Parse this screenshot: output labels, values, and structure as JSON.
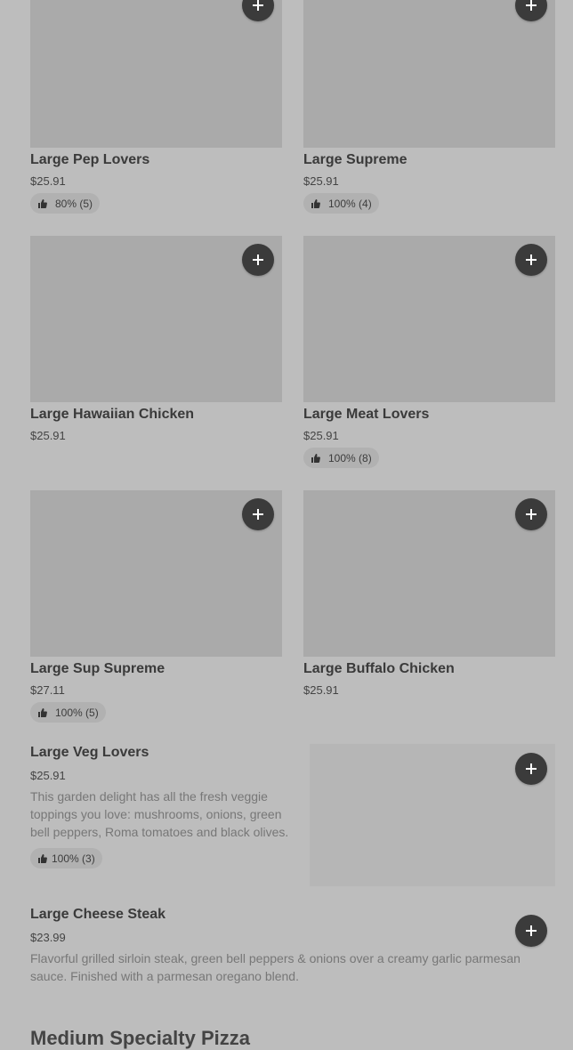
{
  "items": [
    {
      "name": "Large Pep Lovers",
      "price": "$25.91",
      "rating": "80% (5)"
    },
    {
      "name": "Large Supreme",
      "price": "$25.91",
      "rating": "100% (4)"
    },
    {
      "name": "Large Hawaiian Chicken",
      "price": "$25.91"
    },
    {
      "name": "Large Meat Lovers",
      "price": "$25.91",
      "rating": "100% (8)"
    },
    {
      "name": "Large Sup Supreme",
      "price": "$27.11",
      "rating": "100% (5)"
    },
    {
      "name": "Large Buffalo Chicken",
      "price": "$25.91"
    },
    {
      "name": "Large Veg Lovers",
      "price": "$25.91",
      "description": "This garden delight has all the fresh veggie toppings you love: mushrooms, onions, green bell peppers, Roma tomatoes and black olives.",
      "rating": "100% (3)"
    },
    {
      "name": "Large Cheese Steak",
      "price": "$23.99",
      "description": "Flavorful grilled sirloin steak, green bell peppers & onions over a creamy garlic parmesan sauce. Finished with a parmesan oregano blend."
    }
  ],
  "next_section_title": "Medium Specialty Pizza",
  "icons": {
    "add": "plus-icon",
    "rating": "thumbs-up-icon"
  }
}
